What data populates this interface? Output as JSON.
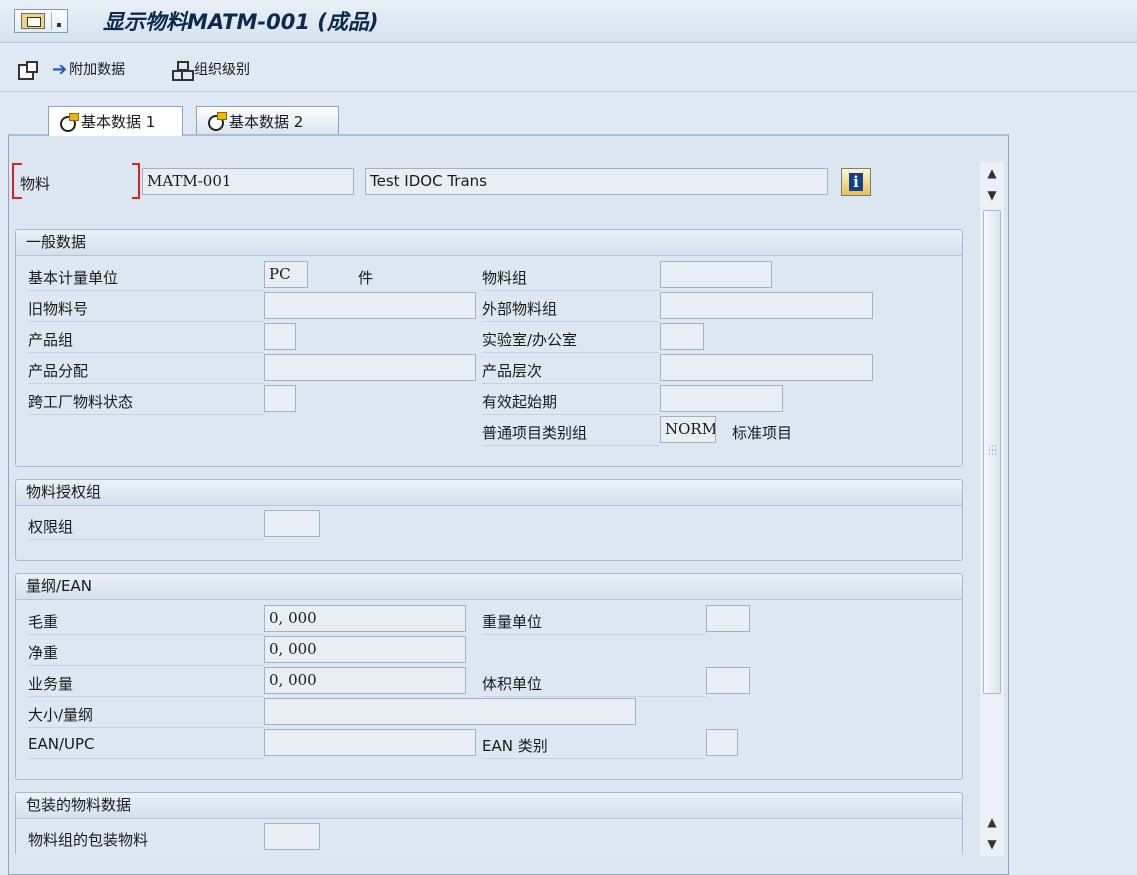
{
  "window": {
    "title": "显示物料MATM-001 (成品)"
  },
  "toolbar": {
    "items": [
      {
        "label": ""
      },
      {
        "label": "附加数据"
      },
      {
        "label": "组织级别"
      }
    ]
  },
  "tabs": [
    {
      "label": "基本数据 1",
      "active": true
    },
    {
      "label": "基本数据 2",
      "active": false
    }
  ],
  "header": {
    "material_label": "物料",
    "material_value": "MATM-001",
    "description_value": "Test IDOC Trans"
  },
  "general": {
    "title": "一般数据",
    "base_uom_label": "基本计量单位",
    "base_uom_value": "PC",
    "base_uom_text": "件",
    "old_material_label": "旧物料号",
    "old_material_value": "",
    "division_label": "产品组",
    "division_value": "",
    "product_alloc_label": "产品分配",
    "product_alloc_value": "",
    "xplant_status_label": "跨工厂物料状态",
    "xplant_status_value": "",
    "material_group_label": "物料组",
    "material_group_value": "",
    "ext_material_group_label": "外部物料组",
    "ext_material_group_value": "",
    "lab_office_label": "实验室/办公室",
    "lab_office_value": "",
    "prod_hierarchy_label": "产品层次",
    "prod_hierarchy_value": "",
    "valid_from_label": "有效起始期",
    "valid_from_value": "",
    "item_cat_group_label": "普通项目类别组",
    "item_cat_group_value": "NORM",
    "item_cat_group_text": "标准项目"
  },
  "authorization": {
    "title": "物料授权组",
    "auth_group_label": "权限组",
    "auth_group_value": ""
  },
  "dimensions": {
    "title": "量纲/EAN",
    "gross_weight_label": "毛重",
    "gross_weight_value": "0, 000",
    "net_weight_label": "净重",
    "net_weight_value": "0, 000",
    "volume_label": "业务量",
    "volume_value": "0, 000",
    "size_label": "大小/量纲",
    "size_value": "",
    "ean_label": "EAN/UPC",
    "ean_value": "",
    "weight_unit_label": "重量单位",
    "weight_unit_value": "",
    "volume_unit_label": "体积单位",
    "volume_unit_value": "",
    "ean_cat_label": "EAN 类别",
    "ean_cat_value": ""
  },
  "packaging": {
    "title": "包装的物料数据",
    "pkg_group_label": "物料组的包装物料",
    "pkg_group_value": ""
  },
  "icons": {
    "menu": "sap-menu-icon",
    "window": "new-window-icon",
    "additional": "arrow-right-icon",
    "org": "org-levels-icon",
    "tab": "tab-status-icon",
    "info": "info-icon",
    "scroll_up": "scroll-up-icon",
    "scroll_down": "scroll-down-icon"
  }
}
